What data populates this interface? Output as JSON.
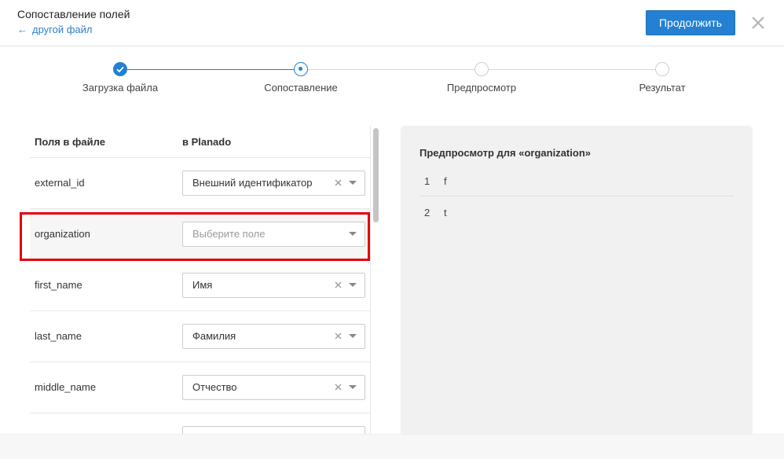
{
  "header": {
    "title": "Сопоставление полей",
    "back_link": "другой файл",
    "continue_label": "Продолжить",
    "close_icon": "close-icon"
  },
  "stepper": {
    "steps": [
      {
        "label": "Загрузка файла",
        "state": "done"
      },
      {
        "label": "Сопоставление",
        "state": "current"
      },
      {
        "label": "Предпросмотр",
        "state": "todo"
      },
      {
        "label": "Результат",
        "state": "todo"
      }
    ]
  },
  "table": {
    "col_file": "Поля в файле",
    "col_planado": "в Planado",
    "rows": [
      {
        "field": "external_id",
        "value": "Внешний идентификатор",
        "placeholder": "",
        "clearable": true
      },
      {
        "field": "organization",
        "value": "",
        "placeholder": "Выберите поле",
        "clearable": false
      },
      {
        "field": "first_name",
        "value": "Имя",
        "placeholder": "",
        "clearable": true
      },
      {
        "field": "last_name",
        "value": "Фамилия",
        "placeholder": "",
        "clearable": true
      },
      {
        "field": "middle_name",
        "value": "Отчество",
        "placeholder": "",
        "clearable": true
      },
      {
        "field": "",
        "value": "",
        "placeholder": "",
        "clearable": false
      }
    ]
  },
  "preview": {
    "title": "Предпросмотр для «organization»",
    "rows": [
      {
        "num": "1",
        "value": "f"
      },
      {
        "num": "2",
        "value": "t"
      }
    ]
  },
  "colors": {
    "accent": "#2380d2",
    "highlight": "#e3000b"
  }
}
